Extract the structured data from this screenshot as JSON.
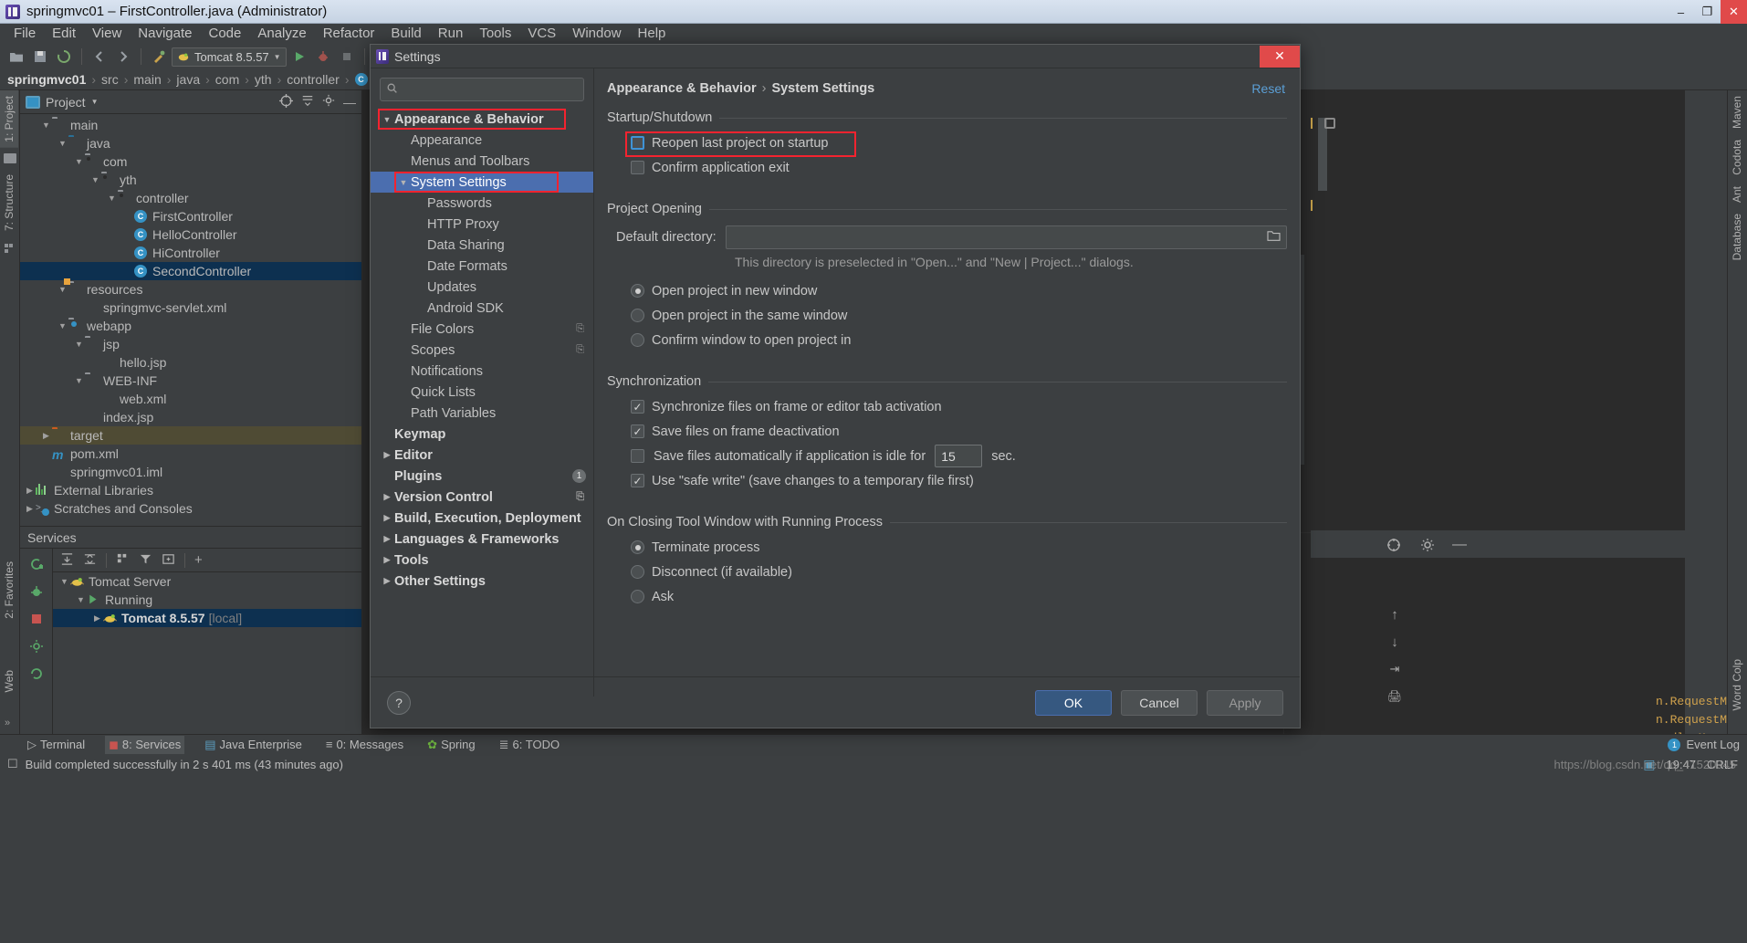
{
  "window": {
    "title": "springmvc01 – FirstController.java (Administrator)",
    "minimize_label": "–",
    "maximize_label": "❐",
    "close_label": "✕"
  },
  "menubar": {
    "items": [
      "File",
      "Edit",
      "View",
      "Navigate",
      "Code",
      "Analyze",
      "Refactor",
      "Build",
      "Run",
      "Tools",
      "VCS",
      "Window",
      "Help"
    ]
  },
  "toolbar": {
    "run_config": "Tomcat 8.5.57",
    "icons": [
      "open-folder-icon",
      "save-icon",
      "sync-icon",
      "back-arrow-icon",
      "forward-arrow-icon",
      "wrench-icon",
      "run-icon",
      "debug-icon",
      "stop-icon",
      "coverage-icon",
      "profile-icon",
      "search-icon",
      "settings-icon",
      "project-structure-icon"
    ]
  },
  "breadcrumbs": {
    "items": [
      "springmvc01",
      "src",
      "main",
      "java",
      "com",
      "yth",
      "controller"
    ],
    "separator": "›"
  },
  "left_strip": {
    "tabs": [
      "1: Project",
      "7: Structure"
    ],
    "bottom_tabs": [
      "2: Favorites",
      "Web"
    ]
  },
  "right_strip": {
    "tabs": [
      "Maven",
      "Codota",
      "Ant",
      "Database",
      "Word Colp"
    ]
  },
  "project_panel": {
    "title": "Project",
    "dropdown_caret": "▼",
    "header_icons": [
      "target-icon",
      "collapse-all-icon",
      "gear-icon",
      "hide-icon"
    ],
    "tree": [
      {
        "label": "main",
        "depth": 2,
        "arrow": "▼",
        "icon": "folder",
        "bold": false
      },
      {
        "label": "java",
        "depth": 3,
        "arrow": "▼",
        "icon": "folder-blue",
        "bold": false
      },
      {
        "label": "com",
        "depth": 4,
        "arrow": "▼",
        "icon": "folder-package",
        "bold": false
      },
      {
        "label": "yth",
        "depth": 5,
        "arrow": "▼",
        "icon": "folder-package",
        "bold": false
      },
      {
        "label": "controller",
        "depth": 6,
        "arrow": "▼",
        "icon": "folder-package",
        "bold": false
      },
      {
        "label": "FirstController",
        "depth": 7,
        "arrow": "",
        "icon": "class",
        "bold": false
      },
      {
        "label": "HelloController",
        "depth": 7,
        "arrow": "",
        "icon": "class",
        "bold": false
      },
      {
        "label": "HiController",
        "depth": 7,
        "arrow": "",
        "icon": "class",
        "bold": false
      },
      {
        "label": "SecondController",
        "depth": 7,
        "arrow": "",
        "icon": "class",
        "bold": false,
        "state": "selected-blue"
      },
      {
        "label": "resources",
        "depth": 3,
        "arrow": "▼",
        "icon": "folder-resources",
        "bold": false
      },
      {
        "label": "springmvc-servlet.xml",
        "depth": 4,
        "arrow": "",
        "icon": "xml-spring",
        "bold": false
      },
      {
        "label": "webapp",
        "depth": 3,
        "arrow": "▼",
        "icon": "folder-webapp",
        "bold": false
      },
      {
        "label": "jsp",
        "depth": 4,
        "arrow": "▼",
        "icon": "folder",
        "bold": false
      },
      {
        "label": "hello.jsp",
        "depth": 5,
        "arrow": "",
        "icon": "jsp",
        "bold": false
      },
      {
        "label": "WEB-INF",
        "depth": 4,
        "arrow": "▼",
        "icon": "folder",
        "bold": false
      },
      {
        "label": "web.xml",
        "depth": 5,
        "arrow": "",
        "icon": "xml-web",
        "bold": false
      },
      {
        "label": "index.jsp",
        "depth": 4,
        "arrow": "",
        "icon": "jsp",
        "bold": false
      },
      {
        "label": "target",
        "depth": 2,
        "arrow": "▶",
        "icon": "folder-orange",
        "bold": false,
        "state": "selected-olive"
      },
      {
        "label": "pom.xml",
        "depth": 2,
        "arrow": "",
        "icon": "maven",
        "bold": false
      },
      {
        "label": "springmvc01.iml",
        "depth": 2,
        "arrow": "",
        "icon": "iml",
        "bold": false
      },
      {
        "label": "External Libraries",
        "depth": 1,
        "arrow": "▶",
        "icon": "libraries",
        "bold": false
      },
      {
        "label": "Scratches and Consoles",
        "depth": 1,
        "arrow": "▶",
        "icon": "scratches",
        "bold": false
      }
    ]
  },
  "services_panel": {
    "title": "Services",
    "toolbar_icons": [
      "rerun-icon",
      "expand-all-icon",
      "collapse-all-icon",
      "group-icon",
      "filter-icon",
      "add-tab-icon",
      "add-icon"
    ],
    "rail_icons": [
      "rerun-icon",
      "debug-icon",
      "stop-icon",
      "settings-icon",
      "refresh-icon"
    ],
    "tree": [
      {
        "label": "Tomcat Server",
        "depth": 1,
        "arrow": "▼",
        "icon": "tomcat-icon",
        "bold": false
      },
      {
        "label": "Running",
        "depth": 2,
        "arrow": "▼",
        "icon": "run-green-icon",
        "bold": false
      },
      {
        "label": "Tomcat 8.5.57",
        "suffix": " [local]",
        "depth": 3,
        "arrow": "▶",
        "icon": "tomcat-icon",
        "bold": true,
        "state": "selected-blue"
      }
    ]
  },
  "console_peek": {
    "lines": [
      "n.RequestMap",
      "n.RequestMap",
      "andlerMappin",
      "andlerMappin"
    ]
  },
  "bottom_bar": {
    "items": [
      {
        "label": "Terminal",
        "icon": "terminal-icon",
        "selected": false
      },
      {
        "label": "8: Services",
        "icon": "services-icon",
        "selected": true
      },
      {
        "label": "Java Enterprise",
        "icon": "java-icon",
        "selected": false
      },
      {
        "label": "0: Messages",
        "icon": "messages-icon",
        "selected": false
      },
      {
        "label": "Spring",
        "icon": "spring-icon",
        "selected": false
      },
      {
        "label": "6: TODO",
        "icon": "todo-icon",
        "selected": false
      }
    ],
    "event_log": "Event Log",
    "event_count": "1"
  },
  "status_bar": {
    "message": "Build completed successfully in 2 s 401 ms (43 minutes ago)",
    "time": "19:47",
    "encoding": "CRLF",
    "watermark": "https://blog.csdn.net/qq_41520945"
  },
  "settings_dialog": {
    "title": "Settings",
    "close_label": "✕",
    "search": {
      "value": "",
      "placeholder": ""
    },
    "reset_label": "Reset",
    "breadcrumb": {
      "parent": "Appearance & Behavior",
      "sep": "›",
      "current": "System Settings"
    },
    "tree": [
      {
        "label": "Appearance & Behavior",
        "depth": 0,
        "arrow": "▼",
        "bold": true,
        "highlight": "red-box"
      },
      {
        "label": "Appearance",
        "depth": 1,
        "arrow": "",
        "bold": false
      },
      {
        "label": "Menus and Toolbars",
        "depth": 1,
        "arrow": "",
        "bold": false
      },
      {
        "label": "System Settings",
        "depth": 1,
        "arrow": "▼",
        "bold": false,
        "state": "selected",
        "highlight": "red-box"
      },
      {
        "label": "Passwords",
        "depth": 2,
        "arrow": "",
        "bold": false
      },
      {
        "label": "HTTP Proxy",
        "depth": 2,
        "arrow": "",
        "bold": false
      },
      {
        "label": "Data Sharing",
        "depth": 2,
        "arrow": "",
        "bold": false
      },
      {
        "label": "Date Formats",
        "depth": 2,
        "arrow": "",
        "bold": false
      },
      {
        "label": "Updates",
        "depth": 2,
        "arrow": "",
        "bold": false
      },
      {
        "label": "Android SDK",
        "depth": 2,
        "arrow": "",
        "bold": false
      },
      {
        "label": "File Colors",
        "depth": 1,
        "arrow": "",
        "bold": false,
        "trailing": "copy-icon"
      },
      {
        "label": "Scopes",
        "depth": 1,
        "arrow": "",
        "bold": false,
        "trailing": "copy-icon"
      },
      {
        "label": "Notifications",
        "depth": 1,
        "arrow": "",
        "bold": false
      },
      {
        "label": "Quick Lists",
        "depth": 1,
        "arrow": "",
        "bold": false
      },
      {
        "label": "Path Variables",
        "depth": 1,
        "arrow": "",
        "bold": false
      },
      {
        "label": "Keymap",
        "depth": 0,
        "arrow": "",
        "bold": true
      },
      {
        "label": "Editor",
        "depth": 0,
        "arrow": "▶",
        "bold": true
      },
      {
        "label": "Plugins",
        "depth": 0,
        "arrow": "",
        "bold": true,
        "badge": "1"
      },
      {
        "label": "Version Control",
        "depth": 0,
        "arrow": "▶",
        "bold": true,
        "trailing": "copy-icon"
      },
      {
        "label": "Build, Execution, Deployment",
        "depth": 0,
        "arrow": "▶",
        "bold": true
      },
      {
        "label": "Languages & Frameworks",
        "depth": 0,
        "arrow": "▶",
        "bold": true
      },
      {
        "label": "Tools",
        "depth": 0,
        "arrow": "▶",
        "bold": true
      },
      {
        "label": "Other Settings",
        "depth": 0,
        "arrow": "▶",
        "bold": true
      }
    ],
    "groups": {
      "startup_shutdown": {
        "title": "Startup/Shutdown",
        "options": [
          {
            "label": "Reopen last project on startup",
            "checked": false,
            "focused": true,
            "highlight": "red-box"
          },
          {
            "label": "Confirm application exit",
            "checked": false,
            "focused": false
          }
        ]
      },
      "project_opening": {
        "title": "Project Opening",
        "default_directory_label": "Default directory:",
        "default_directory_value": "",
        "hint": "This directory is preselected in \"Open...\" and \"New | Project...\" dialogs.",
        "radios": [
          {
            "label": "Open project in new window",
            "selected": true
          },
          {
            "label": "Open project in the same window",
            "selected": false
          },
          {
            "label": "Confirm window to open project in",
            "selected": false
          }
        ]
      },
      "synchronization": {
        "title": "Synchronization",
        "options": [
          {
            "label": "Synchronize files on frame or editor tab activation",
            "checked": true
          },
          {
            "label": "Save files on frame deactivation",
            "checked": true
          },
          {
            "label": "Save files automatically if application is idle for",
            "checked": false,
            "value": "15",
            "suffix": "sec."
          },
          {
            "label": "Use \"safe write\" (save changes to a temporary file first)",
            "checked": true
          }
        ]
      },
      "closing_tool_window": {
        "title": "On Closing Tool Window with Running Process",
        "radios": [
          {
            "label": "Terminate process",
            "selected": true
          },
          {
            "label": "Disconnect (if available)",
            "selected": false
          },
          {
            "label": "Ask",
            "selected": false
          }
        ]
      }
    },
    "footer": {
      "help_label": "?",
      "ok_label": "OK",
      "cancel_label": "Cancel",
      "apply_label": "Apply"
    }
  },
  "colors": {
    "accent_blue": "#4b6eaf",
    "selection_blue": "#0d3050",
    "highlight_red": "#f4232f",
    "link_blue": "#5b9fd6",
    "panel_bg": "#3c3f41",
    "editor_bg": "#2b2b2b"
  }
}
